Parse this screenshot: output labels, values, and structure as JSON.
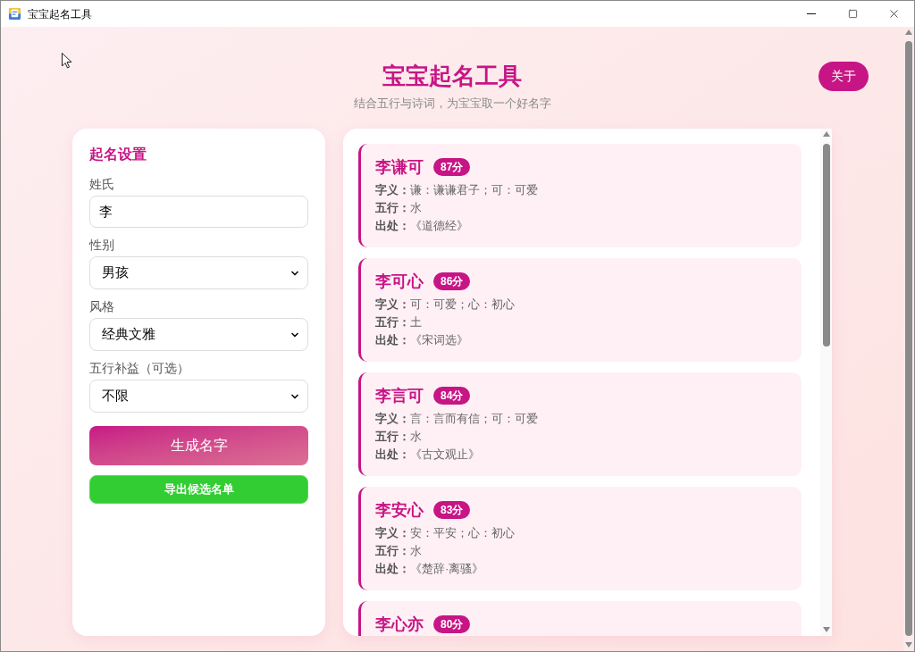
{
  "window": {
    "title": "宝宝起名工具"
  },
  "header": {
    "title": "宝宝起名工具",
    "subtitle": "结合五行与诗词，为宝宝取一个好名字",
    "about_button": "关于"
  },
  "settings": {
    "title": "起名设置",
    "fields": [
      {
        "kind": "input",
        "label": "姓氏",
        "value": "李"
      },
      {
        "kind": "select",
        "label": "性别",
        "value": "男孩"
      },
      {
        "kind": "select",
        "label": "风格",
        "value": "经典文雅"
      },
      {
        "kind": "select",
        "label": "五行补益（可选）",
        "value": "不限"
      }
    ],
    "generate_button": "生成名字",
    "export_button": "导出候选名单"
  },
  "results": [
    {
      "name": "李谦可",
      "score": "87分",
      "details": [
        {
          "label": "字义：",
          "value": "谦：谦谦君子；可：可爱"
        },
        {
          "label": "五行：",
          "value": "水"
        },
        {
          "label": "出处：",
          "value": "《道德经》"
        }
      ]
    },
    {
      "name": "李可心",
      "score": "86分",
      "details": [
        {
          "label": "字义：",
          "value": "可：可爱；心：初心"
        },
        {
          "label": "五行：",
          "value": "土"
        },
        {
          "label": "出处：",
          "value": "《宋词选》"
        }
      ]
    },
    {
      "name": "李言可",
      "score": "84分",
      "details": [
        {
          "label": "字义：",
          "value": "言：言而有信；可：可爱"
        },
        {
          "label": "五行：",
          "value": "水"
        },
        {
          "label": "出处：",
          "value": "《古文观止》"
        }
      ]
    },
    {
      "name": "李安心",
      "score": "83分",
      "details": [
        {
          "label": "字义：",
          "value": "安：平安；心：初心"
        },
        {
          "label": "五行：",
          "value": "水"
        },
        {
          "label": "出处：",
          "value": "《楚辞·离骚》"
        }
      ]
    },
    {
      "name": "李心亦",
      "score": "80分"
    }
  ]
}
